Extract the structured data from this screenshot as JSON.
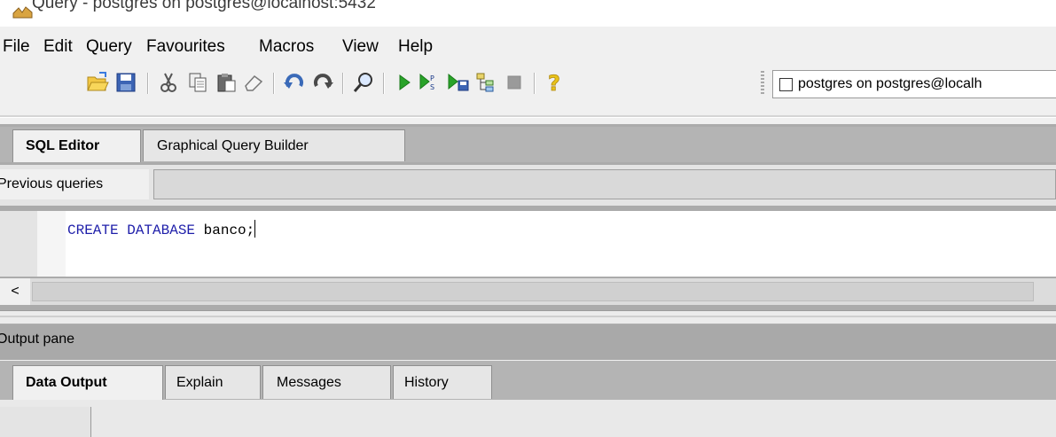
{
  "window": {
    "title": "Query - postgres on postgres@localhost:5432"
  },
  "menu": [
    "File",
    "Edit",
    "Query",
    "Favourites",
    "Macros",
    "View",
    "Help"
  ],
  "toolbar": {
    "buttons": [
      {
        "name": "open-icon"
      },
      {
        "name": "save-icon"
      },
      {
        "name": "cut-icon"
      },
      {
        "name": "copy-icon"
      },
      {
        "name": "paste-icon"
      },
      {
        "name": "clear-icon"
      },
      {
        "name": "undo-icon"
      },
      {
        "name": "redo-icon"
      },
      {
        "name": "find-icon"
      },
      {
        "name": "execute-icon"
      },
      {
        "name": "execute-pgscript-icon"
      },
      {
        "name": "execute-to-file-icon"
      },
      {
        "name": "explain-icon"
      },
      {
        "name": "cancel-query-icon"
      },
      {
        "name": "help-icon"
      }
    ],
    "connection": "postgres on postgres@localh"
  },
  "editor": {
    "tabs": [
      {
        "label": "SQL Editor",
        "active": true
      },
      {
        "label": "Graphical Query Builder",
        "active": false
      }
    ],
    "previous_queries_label": "Previous queries",
    "sql": {
      "keyword1": "CREATE",
      "keyword2": "DATABASE",
      "rest": "banco;"
    },
    "scroll_left": "<"
  },
  "output": {
    "title": "Output pane",
    "tabs": [
      {
        "label": "Data Output",
        "active": true
      },
      {
        "label": "Explain",
        "active": false
      },
      {
        "label": "Messages",
        "active": false
      },
      {
        "label": "History",
        "active": false
      }
    ]
  },
  "colors": {
    "keyword": "#1f1faa",
    "accent_green": "#29a329",
    "help_yellow": "#e8c21a"
  }
}
